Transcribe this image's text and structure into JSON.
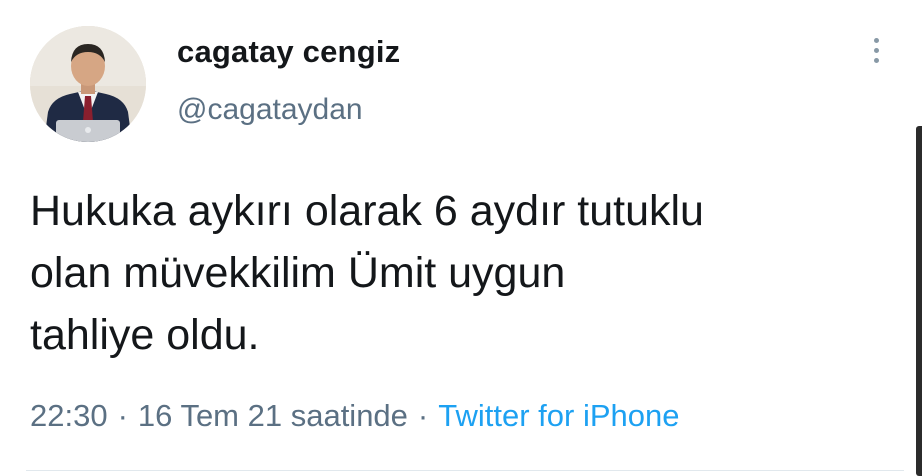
{
  "author": {
    "display_name": "cagatay cengiz",
    "handle": "@cagataydan",
    "avatar_icon": "profile-photo"
  },
  "tweet": {
    "lines": [
      "Hukuka aykırı olarak 6 aydır tutuklu",
      "olan müvekkilim Ümit uygun",
      "tahliye oldu."
    ]
  },
  "meta": {
    "time": "22:30",
    "separator": "·",
    "date": "16 Tem 21 saatinde",
    "source": "Twitter for iPhone"
  },
  "icons": {
    "more": "more-vertical-icon"
  },
  "colors": {
    "text": "#14171a",
    "secondary": "#5b7083",
    "link": "#1da1f2"
  }
}
